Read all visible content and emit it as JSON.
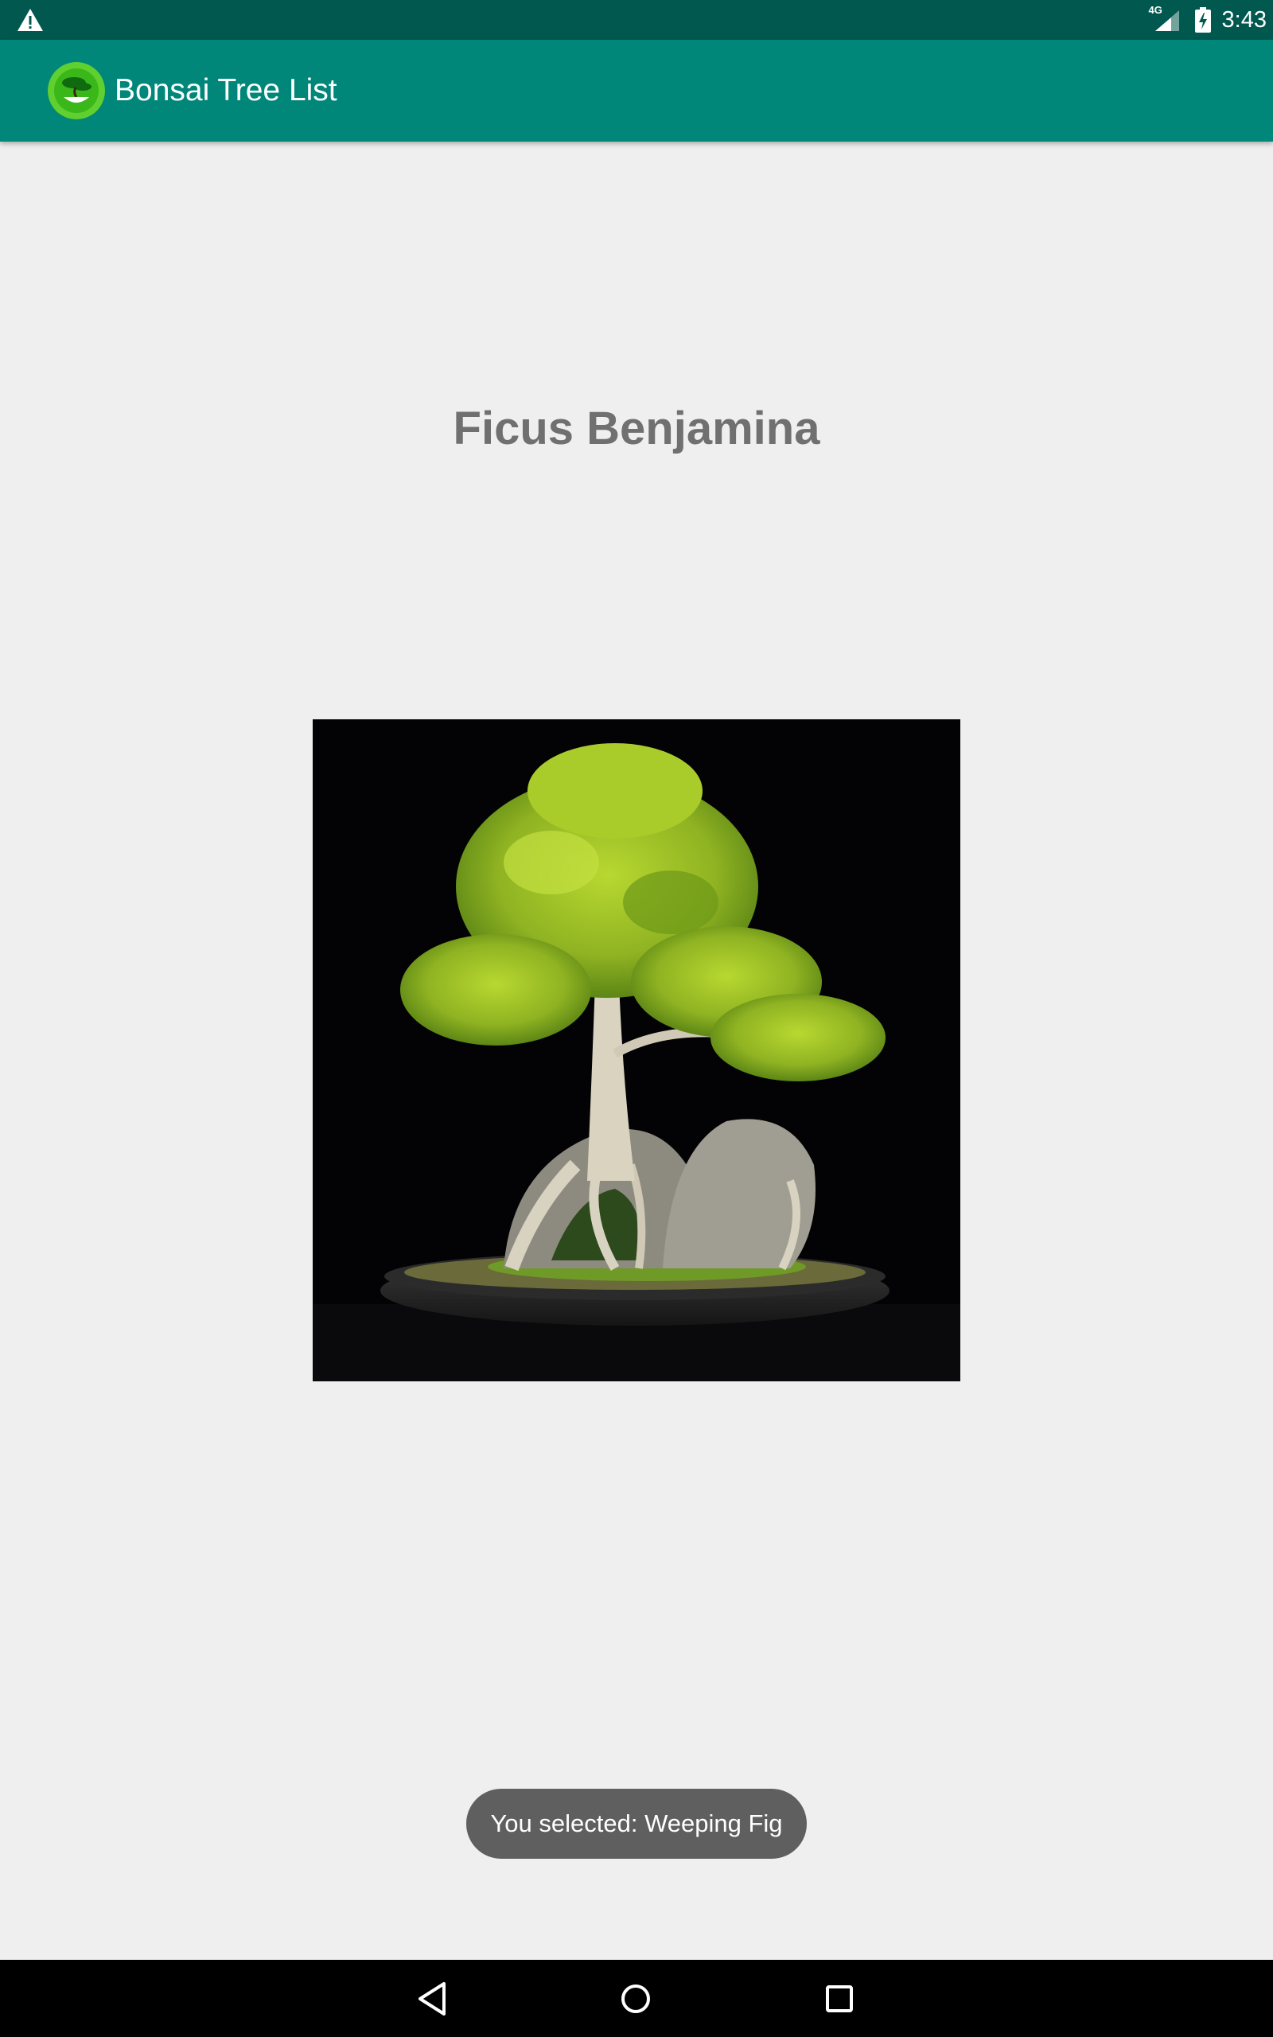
{
  "status_bar": {
    "time": "3:43",
    "network": "4G",
    "icons": [
      "warning-icon",
      "signal-icon",
      "battery-charging-icon"
    ]
  },
  "app_bar": {
    "title": "Bonsai Tree List",
    "icon": "bonsai-app-icon",
    "background_color": "#00877a"
  },
  "detail": {
    "tree_name": "Ficus Benjamina",
    "image": "ficus-bonsai-photo"
  },
  "toast": {
    "message": "You selected: Weeping Fig"
  },
  "nav_bar": {
    "icons": [
      "back-icon",
      "home-icon",
      "recent-apps-icon"
    ]
  }
}
